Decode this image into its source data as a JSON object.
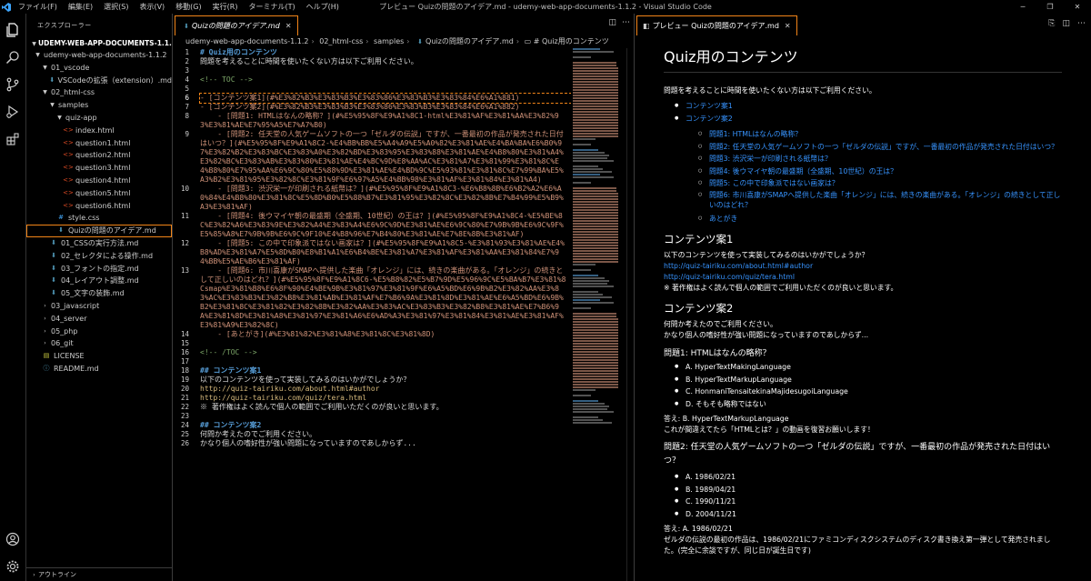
{
  "titlebar": {
    "menus": [
      "ファイル(F)",
      "編集(E)",
      "選択(S)",
      "表示(V)",
      "移動(G)",
      "実行(R)",
      "ターミナル(T)",
      "ヘルプ(H)"
    ],
    "title": "プレビュー Quizの問題のアイデア.md - udemy-web-app-documents-1.1.2 - Visual Studio Code"
  },
  "sidebar": {
    "title": "エクスプローラー",
    "root": "UDEMY-WEB-APP-DOCUMENTS-1.1.2",
    "outline": "アウトライン",
    "items": [
      {
        "label": "udemy-web-app-documents-1.1.2",
        "indent": 1,
        "type": "folder-open"
      },
      {
        "label": "01_vscode",
        "indent": 2,
        "type": "folder-open"
      },
      {
        "label": "VSCodeの拡張（extension）.md",
        "indent": 3,
        "type": "md"
      },
      {
        "label": "02_html-css",
        "indent": 2,
        "type": "folder-open"
      },
      {
        "label": "samples",
        "indent": 3,
        "type": "folder-open"
      },
      {
        "label": "quiz-app",
        "indent": 4,
        "type": "folder-open"
      },
      {
        "label": "index.html",
        "indent": 5,
        "type": "html"
      },
      {
        "label": "question1.html",
        "indent": 5,
        "type": "html"
      },
      {
        "label": "question2.html",
        "indent": 5,
        "type": "html"
      },
      {
        "label": "question3.html",
        "indent": 5,
        "type": "html"
      },
      {
        "label": "question4.html",
        "indent": 5,
        "type": "html"
      },
      {
        "label": "question5.html",
        "indent": 5,
        "type": "html"
      },
      {
        "label": "question6.html",
        "indent": 5,
        "type": "html"
      },
      {
        "label": "style.css",
        "indent": 4,
        "type": "css"
      },
      {
        "label": "Quizの問題のアイデア.md",
        "indent": 4,
        "type": "md",
        "selected": true
      },
      {
        "label": "01_CSSの実行方法.md",
        "indent": 3,
        "type": "md"
      },
      {
        "label": "02_セレクタによる操作.md",
        "indent": 3,
        "type": "md"
      },
      {
        "label": "03_フォントの指定.md",
        "indent": 3,
        "type": "md"
      },
      {
        "label": "04_レイアウト調整.md",
        "indent": 3,
        "type": "md"
      },
      {
        "label": "05_文字の装飾.md",
        "indent": 3,
        "type": "md"
      },
      {
        "label": "03_javascript",
        "indent": 2,
        "type": "folder"
      },
      {
        "label": "04_server",
        "indent": 2,
        "type": "folder"
      },
      {
        "label": "05_php",
        "indent": 2,
        "type": "folder"
      },
      {
        "label": "06_git",
        "indent": 2,
        "type": "folder"
      },
      {
        "label": "LICENSE",
        "indent": 2,
        "type": "license"
      },
      {
        "label": "README.md",
        "indent": 2,
        "type": "info"
      }
    ]
  },
  "editor": {
    "tab": "Quizの問題のアイデア.md",
    "breadcrumb": [
      "udemy-web-app-documents-1.1.2",
      "02_html-css",
      "samples",
      "Quizの問題のアイデア.md",
      "# Quiz用のコンテンツ"
    ],
    "lines": [
      {
        "n": "1",
        "t": "# Quiz用のコンテンツ",
        "c": "c-head"
      },
      {
        "n": "2",
        "t": "問題を考えることに時間を使いたくない方は以下ご利用ください。",
        "c": "c-text"
      },
      {
        "n": "3",
        "t": "",
        "c": "c-text"
      },
      {
        "n": "4",
        "t": "<!-- TOC -->",
        "c": "c-com"
      },
      {
        "n": "5",
        "t": "",
        "c": "c-text"
      },
      {
        "n": "6",
        "t": "- [コンテンツ案1](#%E3%82%B3%E3%83%B3%E3%83%86%E3%83%B3%E3%83%84%E6%A1%881)",
        "c": "c-link",
        "hl": true
      },
      {
        "n": "7",
        "t": "- [コンテンツ案2](#%E3%82%B3%E3%83%B3%E3%83%86%E3%83%B3%E3%83%84%E6%A1%882)",
        "c": "c-link"
      },
      {
        "n": "8",
        "t": "    - [問題1: HTMLはなんの略称？](#%E5%95%8F%E9%A1%8C1-html%E3%81%AF%E3%81%AA%E3%82%93%E3%81%AE%E7%95%A5%E7%A7%B0)",
        "c": "c-link"
      },
      {
        "n": "9",
        "t": "    - [問題2: 任天堂の人気ゲームソフトの一つ「ゼルダの伝説」ですが、一番最初の作品が発売された日付はいつ？](#%E5%95%8F%E9%A1%8C2-%E4%BB%BB%E5%A4%A9%E5%A0%82%E3%81%AE%E4%BA%BA%E6%B0%97%E3%82%B2%E3%83%BC%E3%83%A0%E3%82%BD%E3%83%95%E3%83%88%E3%81%AE%E4%B8%80%E3%81%A4%E3%82%BC%E3%83%AB%E3%83%80%E3%81%AE%E4%BC%9D%E8%AA%AC%E3%81%A7%E3%81%99%E3%81%8C%E4%B8%80%E7%95%AA%E6%9C%80%E5%88%9D%E3%81%AE%E4%BD%9C%E5%93%81%E3%81%8C%E7%99%BA%E5%A3%B2%E3%81%95%E3%82%8C%E3%81%9F%E6%97%A5%E4%BB%98%E3%81%AF%E3%81%84%E3%81%A4)",
        "c": "c-link"
      },
      {
        "n": "10",
        "t": "    - [問題3: 渋沢栄一が印刷される紙幣は？](#%E5%95%8F%E9%A1%8C3-%E6%B8%8B%E6%B2%A2%E6%A0%84%E4%B8%80%E3%81%8C%E5%8D%B0%E5%88%B7%E3%81%95%E3%82%8C%E3%82%8B%E7%B4%99%E5%B9%A3%E3%81%AF)",
        "c": "c-link"
      },
      {
        "n": "11",
        "t": "    - [問題4: 後ウマイヤ朝の最盛期（全盛期、10世紀）の王は？](#%E5%95%8F%E9%A1%8C4-%E5%BE%8C%E3%82%A6%E3%83%9E%E3%82%A4%E3%83%A4%E6%9C%9D%E3%81%AE%E6%9C%80%E7%9B%9B%E6%9C%9F%E5%85%A8%E7%9B%9B%E6%9C%9F10%E4%B8%96%E7%B4%80%E3%81%AE%E7%8E%8B%E3%81%AF)",
        "c": "c-link"
      },
      {
        "n": "12",
        "t": "    - [問題5: この中で印象派ではない画家は？](#%E5%95%8F%E9%A1%8C5-%E3%81%93%E3%81%AE%E4%B8%AD%E3%81%A7%E5%8D%B0%E8%B1%A1%E6%B4%BE%E3%81%A7%E3%81%AF%E3%81%AA%E3%81%84%E7%94%BB%E5%AE%B6%E3%81%AF)",
        "c": "c-link"
      },
      {
        "n": "13",
        "t": "    - [問題6: 市川喜康がSMAPへ提供した楽曲「オレンジ」には、続きの楽曲がある。「オレンジ」の続きとして正しいのはどれ？](#%E5%95%8F%E9%A1%8C6-%E5%B8%82%E5%B7%9D%E5%96%9C%E5%BA%B7%E3%81%8Csmap%E3%81%B8%E6%8F%90%E4%BE%9B%E3%81%97%E3%81%9F%E6%A5%BD%E6%9B%B2%E3%82%AA%E3%83%AC%E3%83%B3%E3%82%B8%E3%81%AB%E3%81%AF%E7%B6%9A%E3%81%8D%E3%81%AE%E6%A5%BD%E6%9B%B2%E3%81%8C%E3%81%82%E3%82%8B%E3%82%AA%E3%83%AC%E3%83%B3%E3%82%B8%E3%81%AE%E7%B6%9A%E3%81%8D%E3%81%A8%E3%81%97%E3%81%A6%E6%AD%A3%E3%81%97%E3%81%84%E3%81%AE%E3%81%AF%E3%81%A9%E3%82%8C)",
        "c": "c-link"
      },
      {
        "n": "14",
        "t": "    - [あとがき](#%E3%81%82%E3%81%A8%E3%81%8C%E3%81%8D)",
        "c": "c-link"
      },
      {
        "n": "15",
        "t": "",
        "c": "c-text"
      },
      {
        "n": "16",
        "t": "<!-- /TOC -->",
        "c": "c-com"
      },
      {
        "n": "17",
        "t": "",
        "c": "c-text"
      },
      {
        "n": "18",
        "t": "## コンテンツ案1",
        "c": "c-head"
      },
      {
        "n": "19",
        "t": "以下のコンテンツを使って実装してみるのはいかがでしょうか？",
        "c": "c-text"
      },
      {
        "n": "20",
        "t": "http://quiz-tairiku.com/about.html#author",
        "c": "c-url"
      },
      {
        "n": "21",
        "t": "http://quiz-tairiku.com/quiz/tera.html",
        "c": "c-url"
      },
      {
        "n": "22",
        "t": "※ 著作権はよく読んで個人の範囲でご利用いただくのが良いと思います。",
        "c": "c-text"
      },
      {
        "n": "23",
        "t": "",
        "c": "c-text"
      },
      {
        "n": "24",
        "t": "## コンテンツ案2",
        "c": "c-head"
      },
      {
        "n": "25",
        "t": "何問か考えたのでご利用ください。",
        "c": "c-text"
      },
      {
        "n": "26",
        "t": "かなり個人の嗜好性が強い問題になっていますのであしからず...",
        "c": "c-text"
      }
    ]
  },
  "preview": {
    "tab": "プレビュー Quizの問題のアイデア.md",
    "h1": "Quiz用のコンテンツ",
    "intro": "問題を考えることに時間を使いたくない方は以下ご利用ください。",
    "toc": [
      "コンテンツ案1",
      "コンテンツ案2"
    ],
    "toc_sub": [
      "問題1: HTMLはなんの略称？",
      "問題2: 任天堂の人気ゲームソフトの一つ「ゼルダの伝説」ですが、一番最初の作品が発売された日付はいつ？",
      "問題3: 渋沢栄一が印刷される紙幣は？",
      "問題4: 後ウマイヤ朝の最盛期（全盛期、10世紀）の王は？",
      "問題5: この中で印象派ではない画家は？",
      "問題6: 市川喜康がSMAPへ提供した楽曲「オレンジ」には、続きの楽曲がある。「オレンジ」の続きとして正しいのはどれ？",
      "あとがき"
    ],
    "c1_title": "コンテンツ案1",
    "c1_p": "以下のコンテンツを使って実装してみるのはいかがでしょうか？",
    "c1_link1": "http://quiz-tairiku.com/about.html#author",
    "c1_link2": "http://quiz-tairiku.com/quiz/tera.html",
    "c1_note": "※ 著作権はよく読んで個人の範囲でご利用いただくのが良いと思います。",
    "c2_title": "コンテンツ案2",
    "c2_p1": "何問か考えたのでご利用ください。",
    "c2_p2": "かなり個人の嗜好性が強い問題になっていますのであしからず...",
    "q1_title": "問題1: HTMLはなんの略称？",
    "q1_opts": [
      "A. HyperTextMakingLanguage",
      "B. HyperTextMarkupLanguage",
      "C. HonmaniTensaitekinaMajidesugoiLanguage",
      "D. そもそも略称ではない"
    ],
    "q1_ans": "答え: B. HyperTextMarkupLanguage",
    "q1_note": "これが間違えてたら「HTMLとは？」の動画を復習お願いします！",
    "q2_title": "問題2: 任天堂の人気ゲームソフトの一つ「ゼルダの伝説」ですが、一番最初の作品が発売された日付はいつ？",
    "q2_opts": [
      "A. 1986/02/21",
      "B. 1989/04/21",
      "C. 1990/11/21",
      "D. 2004/11/21"
    ],
    "q2_ans": "答え: A. 1986/02/21",
    "q2_note": "ゼルダの伝説の最初の作品は、1986/02/21にファミコンディスクシステムのディスク書き換え第一弾として発売されました。(完全に余談ですが、同じ日が誕生日です)"
  }
}
